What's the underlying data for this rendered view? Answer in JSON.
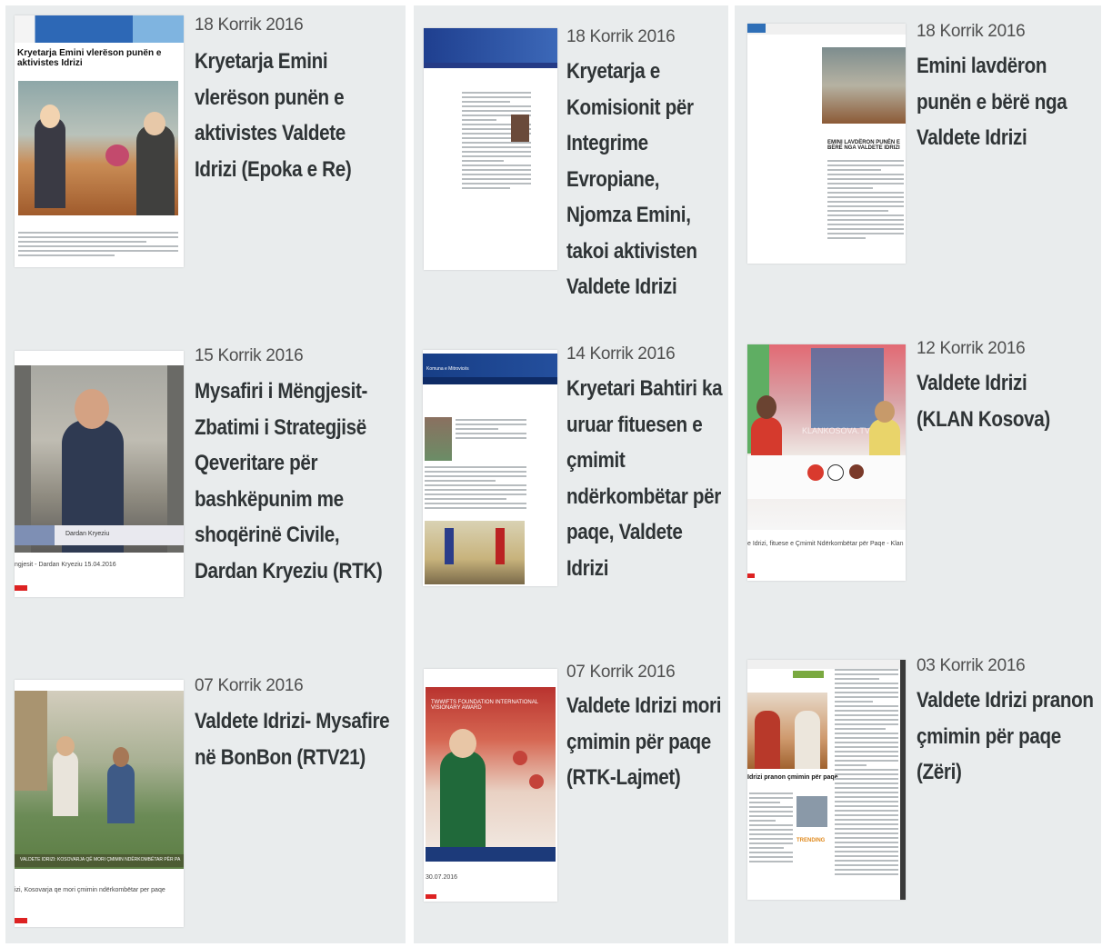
{
  "articles": [
    {
      "date": "18 Korrik 2016",
      "title": "Kryetarja Emini vlerëson punën e aktivistes Valdete Idrizi (Epoka e Re)",
      "thumb": "newspaper-clipping",
      "thumb_headline": "Kryetarja Emini vlerëson punën e aktivistes Idrizi"
    },
    {
      "date": "18 Korrik 2016",
      "title": "Kryetarja e Komisionit për Integrime Evropiane, Njomza Emini, takoi aktivisten Valdete Idrizi",
      "thumb": "website-screenshot"
    },
    {
      "date": "18 Korrik 2016",
      "title": "Emini lavdëron punën e bërë nga Valdete Idrizi",
      "thumb": "website-screenshot",
      "thumb_headline": "EMINI LAVDËRON PUNËN E BËRË NGA VALDETE IDRIZI"
    },
    {
      "date": "15 Korrik 2016",
      "title": "Mysafiri i Mëngjesit- Zbatimi i Strategjisë Qeveritare për bashkëpunim me shoqërinë Civile, Dardan Kryeziu (RTK)",
      "thumb": "tv-screenshot",
      "thumb_caption": "ngjesit - Dardan Kryeziu 15.04.2016",
      "thumb_overlay": "Dardan Kryeziu"
    },
    {
      "date": "14 Korrik 2016",
      "title": "Kryetari Bahtiri ka uruar fituesen e çmimit ndërkombëtar për paqe, Valdete Idrizi",
      "thumb": "website-screenshot",
      "thumb_header": "Komuna e Mitrovicës"
    },
    {
      "date": "12 Korrik 2016",
      "title": "Valdete Idrizi (KLAN Kosova)",
      "thumb": "tv-screenshot",
      "thumb_caption": "e Idrizi, fituese e Çmimit Ndërkombëtar për Paqe - Klan",
      "thumb_overlay": "KLANKOSOVA.TV"
    },
    {
      "date": "07 Korrik 2016",
      "title": "Valdete Idrizi- Mysafire në BonBon (RTV21)",
      "thumb": "tv-screenshot",
      "thumb_caption": "izi, Kosovarja qe mori çmimin ndërkombëtar per paqe",
      "thumb_overlay": "VALDETE IDRIZI: KOSOVARJA QË MORI ÇMIMIN NDËRKOMBËTAR PËR PA"
    },
    {
      "date": "07 Korrik 2016",
      "title": "Valdete Idrizi mori çmimin për paqe (RTK-Lajmet)",
      "thumb": "tv-screenshot",
      "thumb_caption": "30.07.2016",
      "thumb_overlay": "TWWIFTS FOUNDATION INTERNATIONAL VISIONARY AWARD"
    },
    {
      "date": "03 Korrik 2016",
      "title": "Valdete Idrizi pranon çmimin për paqe (Zëri)",
      "thumb": "newspaper-clipping",
      "thumb_headline": "Idrizi pranon çmimin për paqe",
      "thumb_tag": "TRENDING"
    }
  ]
}
